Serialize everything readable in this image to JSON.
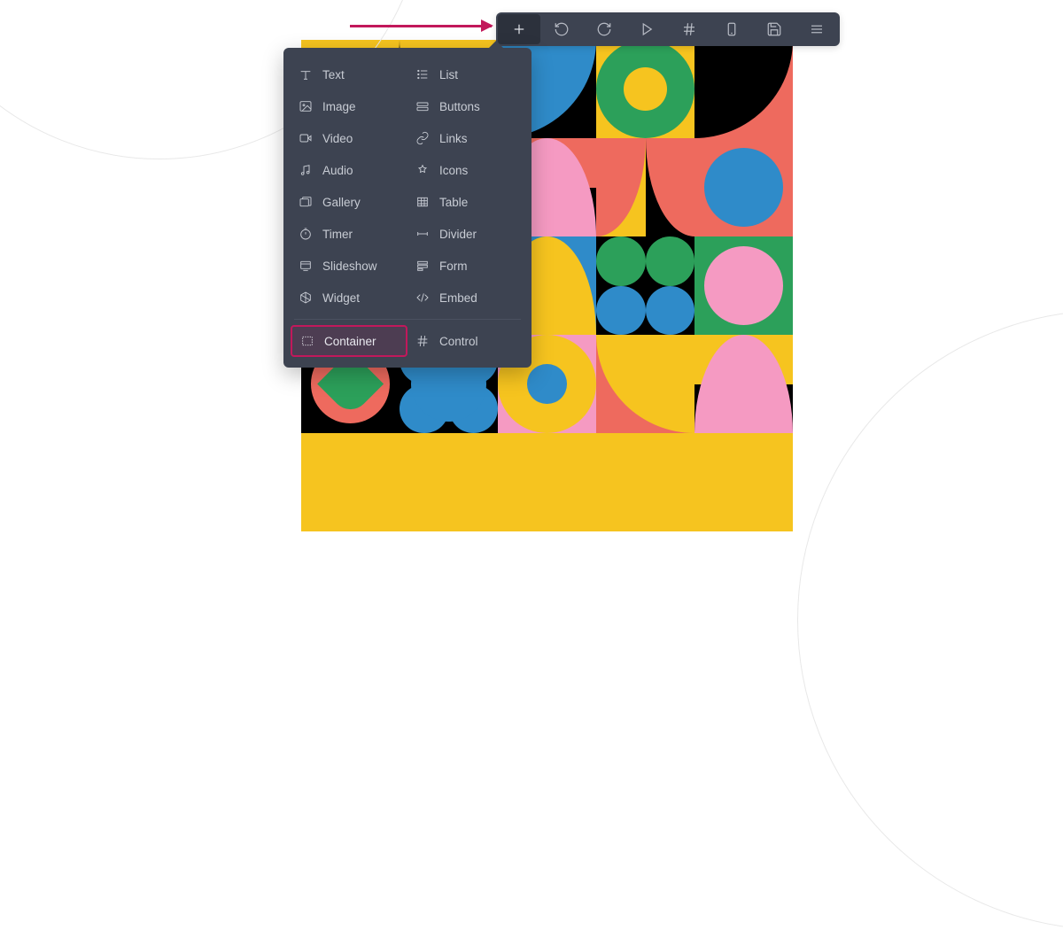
{
  "colors": {
    "panel_bg": "#3d4351",
    "highlight": "#c2185b",
    "text": "#c8ccd4"
  },
  "arrow": {
    "target": "add-button"
  },
  "toolbar": {
    "buttons": [
      {
        "name": "add",
        "icon": "plus-icon",
        "active": true
      },
      {
        "name": "undo",
        "icon": "undo-icon",
        "active": false
      },
      {
        "name": "redo",
        "icon": "redo-icon",
        "active": false
      },
      {
        "name": "preview",
        "icon": "play-icon",
        "active": false
      },
      {
        "name": "grid",
        "icon": "hash-icon",
        "active": false
      },
      {
        "name": "device",
        "icon": "mobile-icon",
        "active": false
      },
      {
        "name": "save",
        "icon": "save-icon",
        "active": false
      },
      {
        "name": "menu",
        "icon": "menu-icon",
        "active": false
      }
    ]
  },
  "add_menu": {
    "left": [
      {
        "label": "Text",
        "icon": "text-icon"
      },
      {
        "label": "Image",
        "icon": "image-icon"
      },
      {
        "label": "Video",
        "icon": "video-icon"
      },
      {
        "label": "Audio",
        "icon": "audio-icon"
      },
      {
        "label": "Gallery",
        "icon": "gallery-icon"
      },
      {
        "label": "Timer",
        "icon": "timer-icon"
      },
      {
        "label": "Slideshow",
        "icon": "slideshow-icon"
      },
      {
        "label": "Widget",
        "icon": "widget-icon"
      }
    ],
    "right": [
      {
        "label": "List",
        "icon": "list-icon"
      },
      {
        "label": "Buttons",
        "icon": "buttons-icon"
      },
      {
        "label": "Links",
        "icon": "links-icon"
      },
      {
        "label": "Icons",
        "icon": "icons-icon"
      },
      {
        "label": "Table",
        "icon": "table-icon"
      },
      {
        "label": "Divider",
        "icon": "divider-icon"
      },
      {
        "label": "Form",
        "icon": "form-icon"
      },
      {
        "label": "Embed",
        "icon": "embed-icon"
      }
    ],
    "bottom": [
      {
        "label": "Container",
        "icon": "container-icon",
        "highlight": true
      },
      {
        "label": "Control",
        "icon": "control-icon",
        "highlight": false
      }
    ]
  }
}
